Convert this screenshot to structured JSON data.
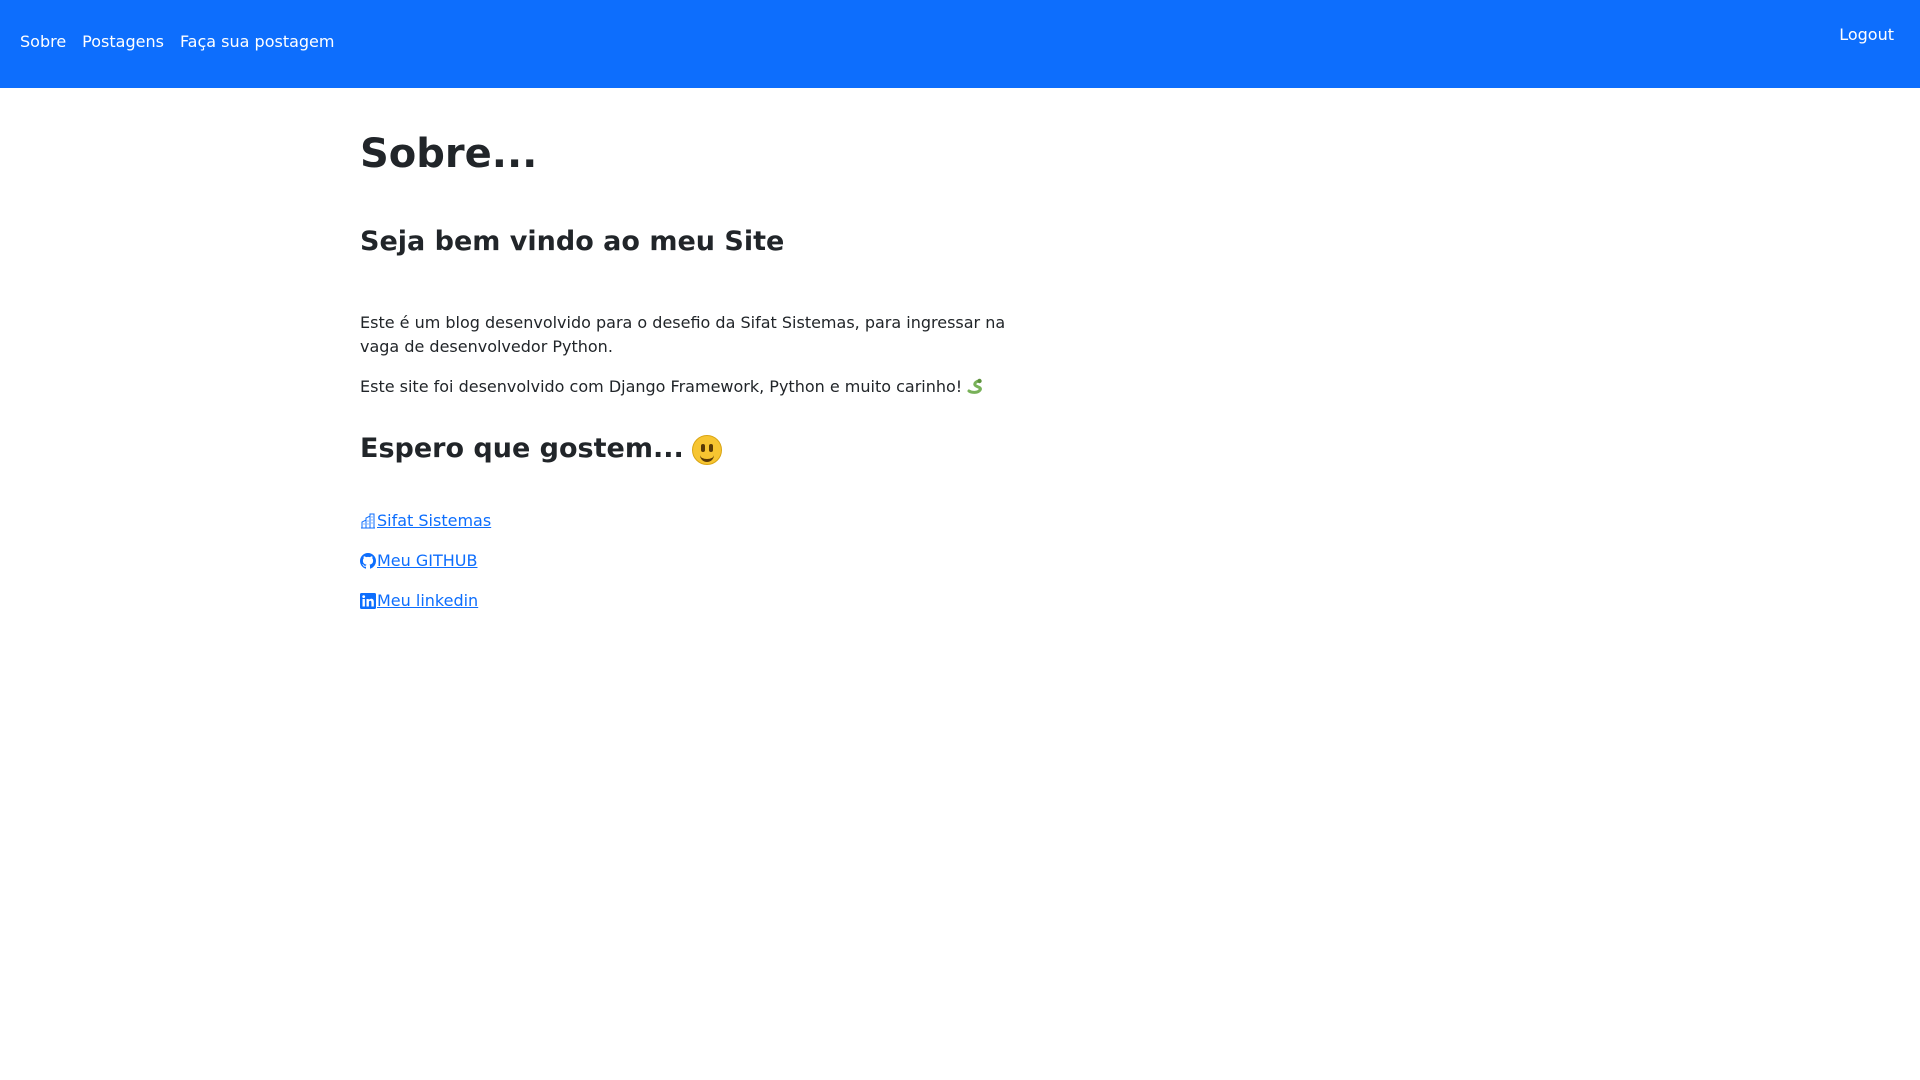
{
  "nav": {
    "items": [
      {
        "label": "Sobre"
      },
      {
        "label": "Postagens"
      },
      {
        "label": "Faça sua postagem"
      }
    ],
    "logout_label": "Logout"
  },
  "page": {
    "title": "Sobre...",
    "welcome_heading": "Seja bem vindo ao meu Site",
    "paragraphs": [
      "Este é um blog desenvolvido para o desefio da Sifat Sistemas, para ingressar na vaga de desenvolvedor Python.",
      "Este site foi desenvolvido com Django Framework, Python e muito carinho!"
    ],
    "hope_heading": "Espero que gostem...",
    "links": [
      {
        "label": "Sifat Sistemas",
        "icon": "building-icon"
      },
      {
        "label": "Meu GITHUB",
        "icon": "github-icon"
      },
      {
        "label": "Meu linkedin",
        "icon": "linkedin-icon"
      }
    ]
  },
  "colors": {
    "navbar": "#0d6efd",
    "link": "#0d6efd",
    "text": "#212529"
  }
}
